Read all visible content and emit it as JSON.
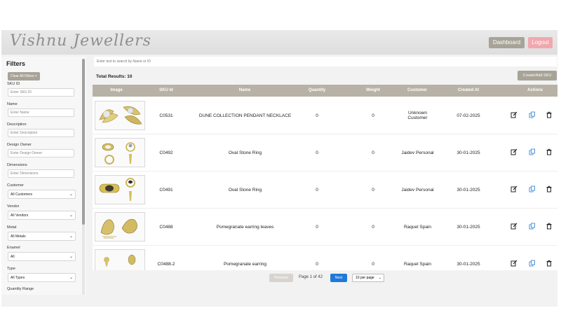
{
  "header": {
    "logo_text": "Vishnu Jewellers",
    "dashboard_label": "Dashboard",
    "logout_label": "Logout"
  },
  "sidebar": {
    "title": "Filters",
    "clear_filters": "Clear All Filters ×",
    "sku_label": "SKU ID",
    "sku_placeholder": "Enter SKU ID",
    "name_label": "Name",
    "name_placeholder": "Enter Name",
    "description_label": "Description",
    "description_placeholder": "Enter Description",
    "design_owner_label": "Design Owner",
    "design_owner_placeholder": "Enter Design Owner",
    "dimensions_label": "Dimensions",
    "dimensions_placeholder": "Enter Dimensions",
    "customer_label": "Customer",
    "customer_value": "All Customers",
    "vendor_label": "Vendor",
    "vendor_value": "All Vendors",
    "metal_label": "Metal",
    "metal_value": "All Metals",
    "enamel_label": "Enamel",
    "enamel_value": "All",
    "type_label": "Type",
    "type_value": "All Types",
    "quantity_range_label": "Quantity Range"
  },
  "main": {
    "search_placeholder": "Enter text to search by Name or ID",
    "total_results": "Total Results: 10",
    "create_label": "Create/Add SKU"
  },
  "table": {
    "headers": [
      "Image",
      "SKU Id",
      "Name",
      "Quantity",
      "Weight",
      "Customer",
      "Created At",
      "Actions"
    ],
    "rows": [
      {
        "sku": "C0531",
        "name": "DUNE COLLECTION PENDANT NECKLACE",
        "quantity": "0",
        "weight": "0",
        "customer": "Unknown Customer",
        "created": "07-02-2025"
      },
      {
        "sku": "C0492",
        "name": "Oval Stone Ring",
        "quantity": "0",
        "weight": "0",
        "customer": "Jaidev Personal",
        "created": "30-01-2025"
      },
      {
        "sku": "C0491",
        "name": "Oval Stone Ring",
        "quantity": "0",
        "weight": "0",
        "customer": "Jaidev Personal",
        "created": "30-01-2025"
      },
      {
        "sku": "C0488",
        "name": "Pomegranate earring leaves",
        "quantity": "0",
        "weight": "0",
        "customer": "Raquel Spain",
        "created": "30-01-2025"
      },
      {
        "sku": "C0488-2",
        "name": "Pomegranate earring",
        "quantity": "0",
        "weight": "0",
        "customer": "Raquel Spain",
        "created": "30-01-2025"
      }
    ]
  },
  "pagination": {
    "previous_label": "Previous",
    "page_text": "Page 1 of 42",
    "next_label": "Next",
    "per_page_value": "10 per page"
  },
  "icons": {
    "edit": "edit-icon",
    "copy": "copy-icon",
    "delete": "trash-icon"
  },
  "colors": {
    "accent": "#a7a397",
    "logout": "#f0a8ae",
    "next": "#1e7ad8",
    "table_header": "#b8b1a5",
    "copy_icon": "#3b8bd9"
  }
}
